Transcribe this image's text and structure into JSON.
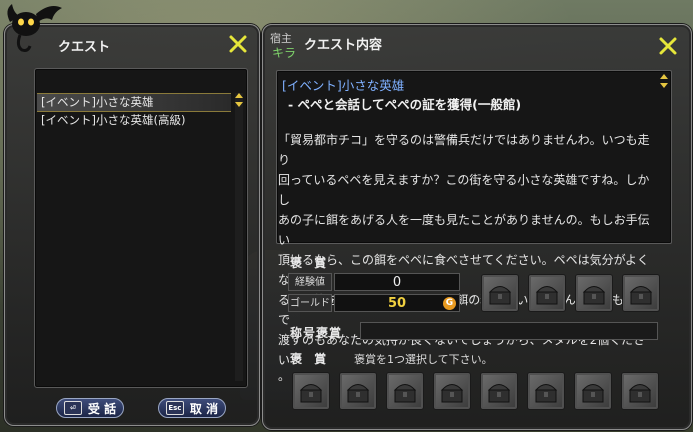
{
  "left_panel": {
    "title": "クエスト",
    "quests": [
      {
        "label": "[イベント]小さな英雄",
        "selected": true
      },
      {
        "label": "[イベント]小さな英雄(高級)",
        "selected": false
      }
    ],
    "accept_button": {
      "icon_text": "⏎",
      "label": "受 話"
    },
    "cancel_button": {
      "icon_text": "Esc",
      "label": "取 消"
    }
  },
  "right_panel": {
    "npc_role": "宿主",
    "npc_name": "キラ",
    "title": "クエスト内容",
    "quest_name": "[イベント]小さな英雄",
    "objective": "- ペペと会話してペペの証を獲得(一般館)",
    "description_lines": [
      "「貿易都市チコ」を守るのは警備兵だけではありませんわ。いつも走り",
      "回っているペペを見えますか？この街を守る小さな英雄ですね。しかし",
      "あの子に餌をあげる人を一度も見たことがありませんの。もしお手伝い",
      "頂けるなら、この餌をペペに食べさせてください。ペペは気分がよくな",
      "るとお礼をするいい子なんです。餌の料金はいりませんわ。でもただで",
      "渡すのもあなたの気持が良くないでしょうから、メダルを2個ください",
      "。"
    ],
    "reward_label": "褒 賞",
    "exp_label": "経験値",
    "exp_value": "0",
    "gold_label": "ゴールド",
    "gold_value": "50",
    "gold_icon": "G",
    "title_reward_label": "称号褒賞",
    "title_reward_value": "",
    "choice_reward_label": "褒 賞",
    "choice_reward_hint": "褒賞を1つ選択して下さい。"
  },
  "colors": {
    "accent_yellow": "#e6e63a",
    "quest_blue": "#7fb0ff",
    "gold_yellow": "#f0d040",
    "npc_green": "#7ed26a"
  }
}
